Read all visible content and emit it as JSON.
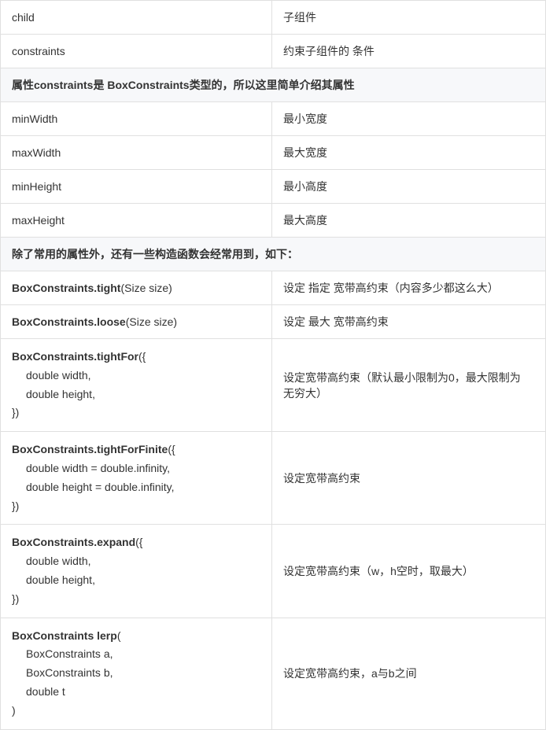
{
  "rows": [
    {
      "type": "kv",
      "key": "child",
      "val": "子组件"
    },
    {
      "type": "kv",
      "key": "constraints",
      "val": "约束子组件的 条件"
    },
    {
      "type": "section",
      "text": "属性constraints是 BoxConstraints类型的，所以这里简单介绍其属性"
    },
    {
      "type": "kv",
      "key": "minWidth",
      "val": "最小宽度"
    },
    {
      "type": "kv",
      "key": "maxWidth",
      "val": "最大宽度"
    },
    {
      "type": "kv",
      "key": "minHeight",
      "val": "最小高度"
    },
    {
      "type": "kv",
      "key": "maxHeight",
      "val": "最大高度"
    },
    {
      "type": "section",
      "text": "除了常用的属性外，还有一些构造函数会经常用到，如下："
    },
    {
      "type": "fn",
      "name": "BoxConstraints.tight",
      "args_inline": "(Size size)",
      "desc": "设定 指定 宽带高约束（内容多少都这么大）"
    },
    {
      "type": "fn",
      "name": "BoxConstraints.loose",
      "args_inline": "(Size size)",
      "desc": "设定 最大 宽带高约束"
    },
    {
      "type": "fnblock",
      "name": "BoxConstraints.tightFor",
      "open": "({",
      "params": [
        "double width,",
        "double height,"
      ],
      "close": "})",
      "desc": "设定宽带高约束（默认最小限制为0，最大限制为 无穷大）"
    },
    {
      "type": "fnblock",
      "name": "BoxConstraints.tightForFinite",
      "open": "({",
      "params": [
        "double width = double.infinity,",
        "double height = double.infinity,"
      ],
      "close": "})",
      "desc": "设定宽带高约束"
    },
    {
      "type": "fnblock",
      "name": "BoxConstraints.expand",
      "open": "({",
      "params": [
        "double width,",
        "double height,"
      ],
      "close": "})",
      "desc": "设定宽带高约束（w，h空时，取最大）"
    },
    {
      "type": "fnblock",
      "name": "BoxConstraints lerp",
      "open": "(",
      "params": [
        "BoxConstraints a,",
        "BoxConstraints b,",
        "double t"
      ],
      "close": ")",
      "desc": "设定宽带高约束，a与b之间"
    }
  ]
}
